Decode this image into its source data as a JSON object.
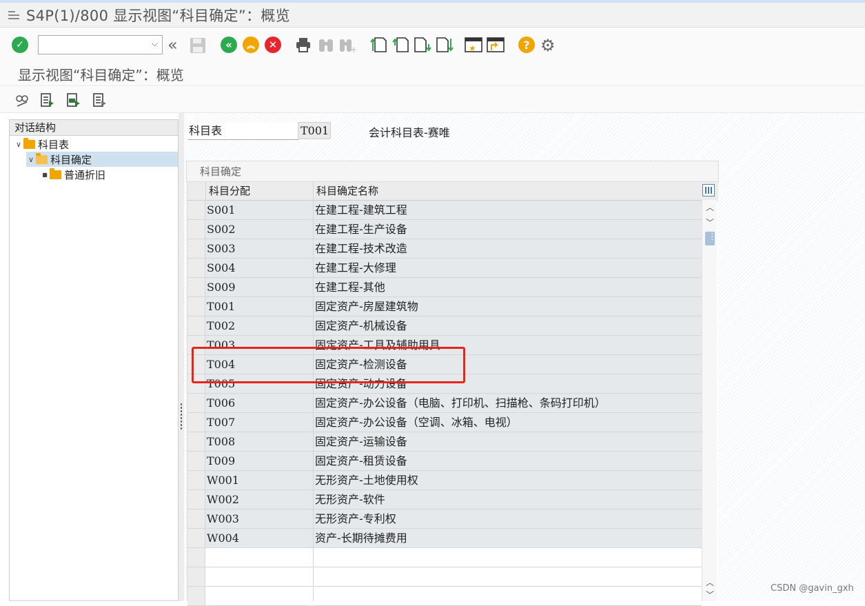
{
  "window": {
    "title": "S4P(1)/800 显示视图“科目确定”：概览"
  },
  "toolbar": {
    "command_field_value": "",
    "buttons": [
      "enter-icon",
      "dropdown-icon",
      "collapse-left-icon",
      "save-icon",
      "back-icon",
      "exit-icon",
      "cancel-icon",
      "print-icon",
      "find-icon",
      "find-next-icon",
      "first-page-icon",
      "previous-page-icon",
      "next-page-icon",
      "last-page-icon",
      "create-session-icon",
      "shortcut-icon",
      "help-icon",
      "settings-icon"
    ],
    "colors": {
      "enter": "#2da94f",
      "back": "#2da94f",
      "exit": "#f0a500",
      "cancel": "#e5262d",
      "help": "#f0a500"
    }
  },
  "page": {
    "title": "显示视图“科目确定”：概览"
  },
  "app_toolbar": {
    "icons": [
      "display-change-icon",
      "select-all-icon",
      "select-block-icon",
      "deselect-all-icon"
    ]
  },
  "tree": {
    "header": "对话结构",
    "nodes": [
      {
        "label": "科目表",
        "level": 0,
        "expanded": true
      },
      {
        "label": "科目确定",
        "level": 1,
        "expanded": true,
        "selected": true
      },
      {
        "label": "普通折旧",
        "level": 2
      }
    ]
  },
  "filter": {
    "label": "科目表",
    "value": "T001",
    "description": "会计科目表-赛唯"
  },
  "group": {
    "title": "科目确定"
  },
  "table": {
    "columns": [
      "科目分配",
      "科目确定名称"
    ],
    "rows": [
      [
        "S001",
        "在建工程-建筑工程"
      ],
      [
        "S002",
        "在建工程-生产设备"
      ],
      [
        "S003",
        "在建工程-技术改造"
      ],
      [
        "S004",
        "在建工程-大修理"
      ],
      [
        "S009",
        "在建工程-其他"
      ],
      [
        "T001",
        "固定资产-房屋建筑物"
      ],
      [
        "T002",
        "固定资产-机械设备"
      ],
      [
        "T003",
        "固定资产-工具及辅助用具"
      ],
      [
        "T004",
        "固定资产-检测设备"
      ],
      [
        "T005",
        "固定资产-动力设备"
      ],
      [
        "T006",
        "固定资产-办公设备（电脑、打印机、扫描枪、条码打印机）"
      ],
      [
        "T007",
        "固定资产-办公设备（空调、冰箱、电视）"
      ],
      [
        "T008",
        "固定资产-运输设备"
      ],
      [
        "T009",
        "固定资产-租赁设备"
      ],
      [
        "W001",
        "无形资产-土地使用权"
      ],
      [
        "W002",
        "无形资产-软件"
      ],
      [
        "W003",
        "无形资产-专利权"
      ],
      [
        "W004",
        "资产-长期待摊费用"
      ]
    ],
    "highlight_color": "#e4261d"
  },
  "watermark": "CSDN @gavin_gxh"
}
